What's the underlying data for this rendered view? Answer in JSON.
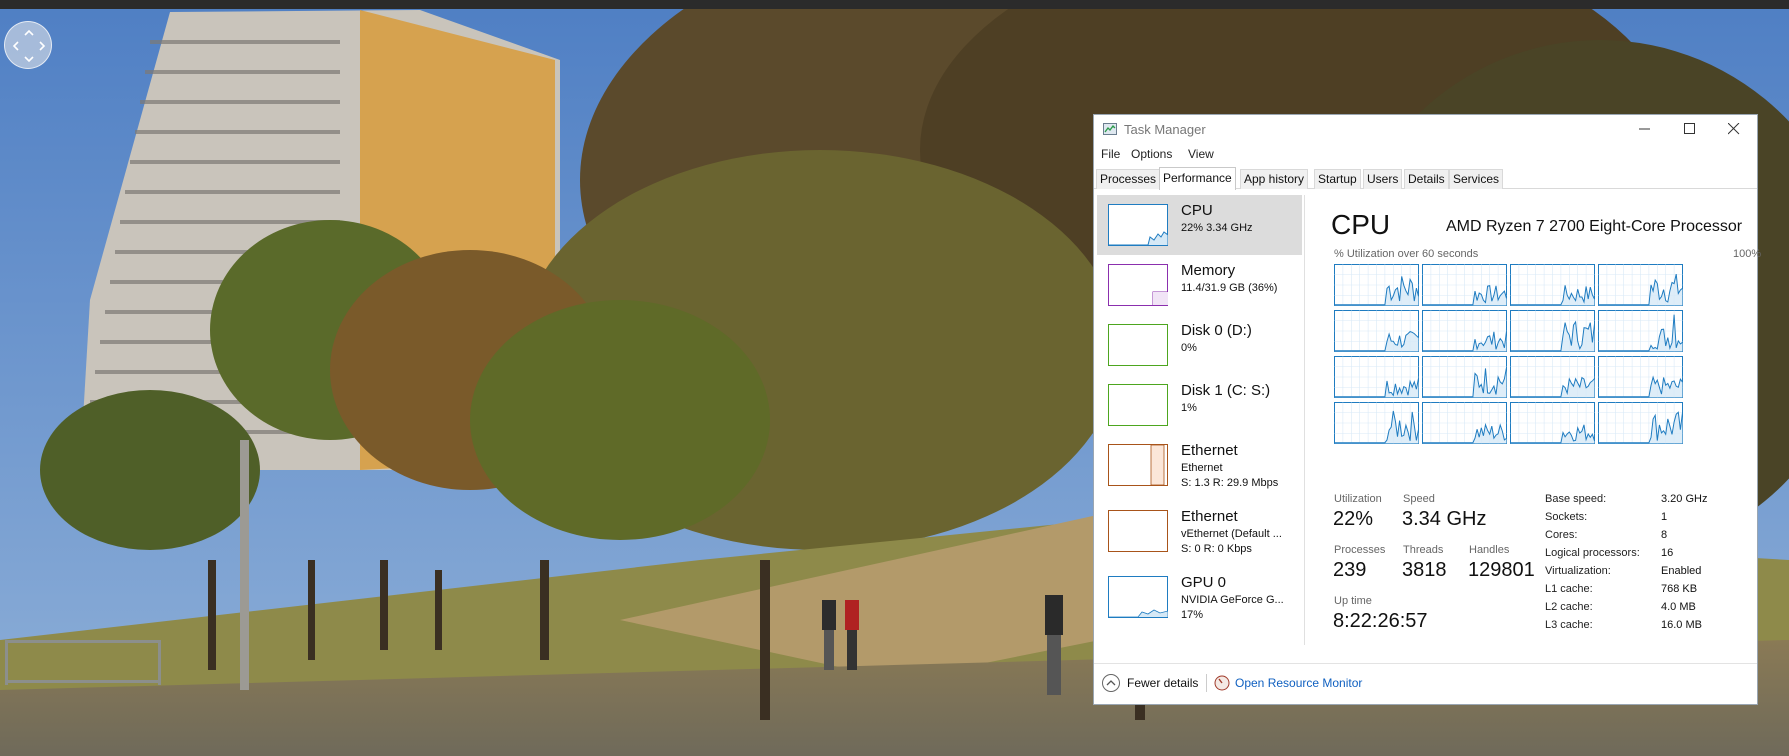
{
  "window": {
    "title": "Task Manager",
    "icon": "task-manager-icon"
  },
  "menu": [
    "File",
    "Options",
    "View"
  ],
  "tabs": [
    "Processes",
    "Performance",
    "App history",
    "Startup",
    "Users",
    "Details",
    "Services"
  ],
  "active_tab": "Performance",
  "sidebar": {
    "items": [
      {
        "name": "CPU",
        "line1": "22% 3.34 GHz",
        "line2": "",
        "color": "#1f7cc1",
        "selected": true
      },
      {
        "name": "Memory",
        "line1": "11.4/31.9 GB (36%)",
        "line2": "",
        "color": "#8b2fae",
        "selected": false
      },
      {
        "name": "Disk 0 (D:)",
        "line1": "0%",
        "line2": "",
        "color": "#4da61f",
        "selected": false
      },
      {
        "name": "Disk 1 (C: S:)",
        "line1": "1%",
        "line2": "",
        "color": "#4da61f",
        "selected": false
      },
      {
        "name": "Ethernet",
        "line1": "Ethernet",
        "line2": "S: 1.3  R: 29.9 Mbps",
        "color": "#a8541a",
        "selected": false
      },
      {
        "name": "Ethernet",
        "line1": "vEthernet (Default ...",
        "line2": "S: 0  R: 0 Kbps",
        "color": "#a8541a",
        "selected": false
      },
      {
        "name": "GPU 0",
        "line1": "NVIDIA GeForce G...",
        "line2": "17%",
        "color": "#1f7cc1",
        "selected": false
      }
    ]
  },
  "cpu": {
    "title": "CPU",
    "model": "AMD Ryzen 7 2700 Eight-Core Processor",
    "graph_caption": "% Utilization over 60 seconds",
    "graph_max": "100%",
    "graph_color": "#1f7cc1",
    "logical_graphs": 16,
    "stats": {
      "utilization_label": "Utilization",
      "utilization": "22%",
      "speed_label": "Speed",
      "speed": "3.34 GHz",
      "processes_label": "Processes",
      "processes": "239",
      "threads_label": "Threads",
      "threads": "3818",
      "handles_label": "Handles",
      "handles": "129801",
      "uptime_label": "Up time",
      "uptime": "8:22:26:57"
    },
    "info": [
      {
        "key": "Base speed:",
        "value": "3.20 GHz"
      },
      {
        "key": "Sockets:",
        "value": "1"
      },
      {
        "key": "Cores:",
        "value": "8"
      },
      {
        "key": "Logical processors:",
        "value": "16"
      },
      {
        "key": "Virtualization:",
        "value": "Enabled"
      },
      {
        "key": "L1 cache:",
        "value": "768 KB"
      },
      {
        "key": "L2 cache:",
        "value": "4.0 MB"
      },
      {
        "key": "L3 cache:",
        "value": "16.0 MB"
      }
    ]
  },
  "footer": {
    "fewer_details": "Fewer details",
    "resource_monitor": "Open Resource Monitor"
  }
}
